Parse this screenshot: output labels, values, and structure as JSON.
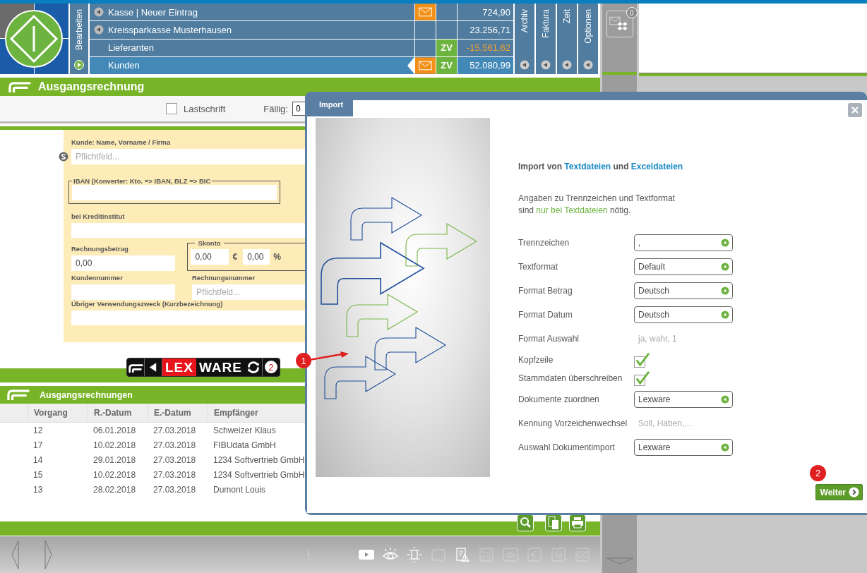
{
  "header": {
    "edit_tab": {
      "label": "Bearbeiten"
    },
    "accounts": [
      {
        "name": "Kasse | Neuer Eintrag",
        "expandable": true,
        "mail": true,
        "amount": "724,90",
        "color": "#ffffff",
        "selected": false
      },
      {
        "name": "Kreissparkasse Musterhausen",
        "expandable": true,
        "mail": false,
        "amount": "23.256,71",
        "color": "#ffffff",
        "selected": false
      },
      {
        "name": "Lieferanten",
        "expandable": false,
        "mail": false,
        "badge": "ZV",
        "amount": "-15.561,62",
        "color": "#f0a030",
        "selected": false
      },
      {
        "name": "Kunden",
        "expandable": false,
        "mail": true,
        "badge": "ZV",
        "amount": "52.080,99",
        "color": "#ffffff",
        "selected": true
      }
    ],
    "side_tabs": [
      {
        "label": "Archiv"
      },
      {
        "label": "Faktura"
      },
      {
        "label": "Zeit"
      },
      {
        "label": "Optionen"
      }
    ]
  },
  "inbox": {
    "count": "0"
  },
  "invoice_form": {
    "title": "Ausgangsrechnung",
    "direct_debit": {
      "label": "Lastschrift",
      "checked": false
    },
    "due": {
      "label": "Fällig:",
      "value": "0"
    },
    "customer": {
      "label": "Kunde: Name, Vorname / Firma",
      "placeholder": "Pflichtfeld..."
    },
    "iban": {
      "legend": "IBAN (Konverter: Kto. => IBAN, BLZ => BIC"
    },
    "bank": {
      "label": "bei Kreditinstitut"
    },
    "amount": {
      "label": "Rechnungsbetrag",
      "value": "0,00"
    },
    "discount": {
      "legend": "Skonto",
      "amount": "0,00",
      "amount_unit": "€",
      "percent": "0,00",
      "percent_unit": "%"
    },
    "customer_number": {
      "label": "Kundennummer"
    },
    "invoice_number": {
      "label": "Rechnungsnummer",
      "placeholder": "Pflichtfeld..."
    },
    "purpose": {
      "label": "Übriger Verwendungszweck (Kurzbezeichnung)"
    }
  },
  "toolbar": {
    "logo": {
      "marked": "LEX",
      "rest": "WARE"
    },
    "badge": "2"
  },
  "callout": {
    "number": "1"
  },
  "invoice_list": {
    "title": "Ausgangsrechnungen",
    "columns": [
      "Vorgang",
      "R.-Datum",
      "E.-Datum",
      "Empfänger"
    ],
    "rows": [
      [
        "12",
        "06.01.2018",
        "27.03.2018",
        "Schweizer Klaus"
      ],
      [
        "17",
        "10.02.2018",
        "27.03.2018",
        "FIBUdata GmbH"
      ],
      [
        "14",
        "29.01.2018",
        "27.03.2018",
        "1234 Softvertrieb GmbH"
      ],
      [
        "15",
        "10.02.2018",
        "27.03.2018",
        "1234 Softvertrieb GmbH"
      ],
      [
        "13",
        "28.02.2018",
        "27.03.2018",
        "Dumont Louis"
      ]
    ]
  },
  "status_bar": {
    "icons": [
      {
        "kind": "alert",
        "disabled": true
      },
      {
        "kind": "video",
        "disabled": false
      },
      {
        "kind": "eye",
        "disabled": false
      },
      {
        "kind": "idea",
        "disabled": false
      },
      {
        "kind": "tablet",
        "disabled": true
      },
      {
        "kind": "checklist",
        "disabled": false
      },
      {
        "kind": "save",
        "disabled": true
      },
      {
        "kind": "eyebox",
        "disabled": true
      },
      {
        "kind": "euro",
        "disabled": true
      },
      {
        "kind": "at",
        "disabled": true
      },
      {
        "kind": "mail",
        "disabled": true
      }
    ]
  },
  "import_dialog": {
    "tab": "Import",
    "heading": {
      "prefix": "Import von ",
      "first_link": "Textdateien",
      "middle": " und ",
      "second_link": "Exceldateien"
    },
    "note": {
      "before": "Angaben zu Trennzeichen und Textformat\nsind ",
      "highlight": "nur bei Textdateien",
      "after": " nötig."
    },
    "settings": [
      {
        "kind": "select",
        "label": "Trennzeichen",
        "value": ","
      },
      {
        "kind": "select",
        "label": "Textformat",
        "value": "Default"
      },
      {
        "kind": "select",
        "label": "Format Betrag",
        "value": "Deutsch"
      },
      {
        "kind": "select",
        "label": "Format Datum",
        "value": "Deutsch"
      },
      {
        "kind": "hint",
        "label": "Format Auswahl",
        "placeholder": "ja, wahr, 1"
      },
      {
        "kind": "checkbox",
        "label": "Kopfzeile",
        "checked": true
      },
      {
        "kind": "checkbox",
        "label": "Stammdaten überschreiben",
        "checked": true
      },
      {
        "kind": "select",
        "label": "Dokumente zuordnen",
        "value": "Lexware"
      },
      {
        "kind": "hint",
        "label": "Kennung Vorzeichenwechsel",
        "placeholder": "Soll, Haben,..."
      },
      {
        "kind": "select",
        "label": "Auswahl Dokumentimport",
        "value": "Lexware"
      }
    ],
    "callout": "2",
    "button": "Weiter"
  }
}
